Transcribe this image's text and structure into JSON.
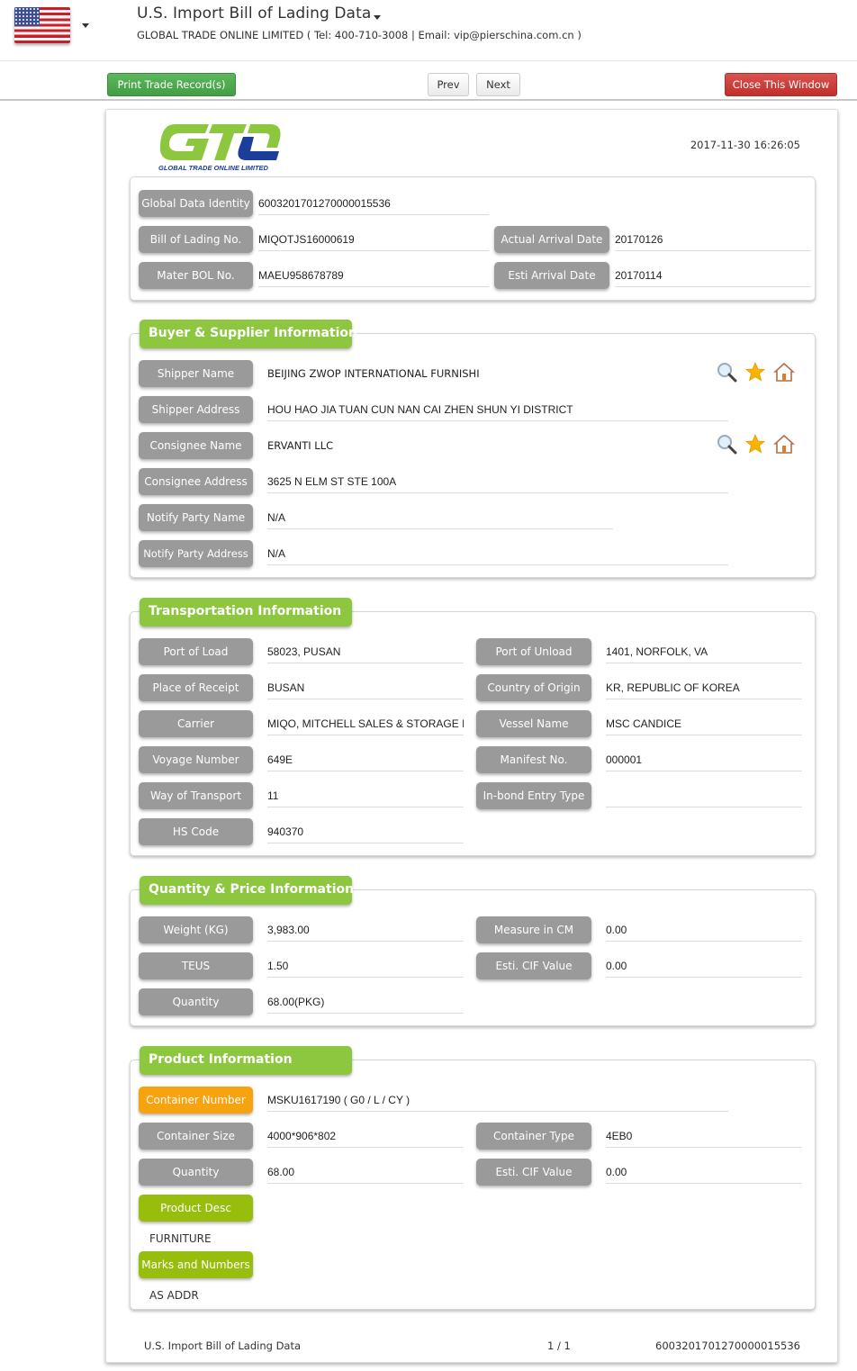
{
  "header": {
    "country_flag": "us-flag-icon",
    "title": "U.S. Import Bill of Lading Data",
    "subtitle": "GLOBAL TRADE ONLINE LIMITED ( Tel: 400-710-3008 | Email: vip@pierschina.com.cn )"
  },
  "toolbar": {
    "print_label": "Print Trade Record(s)",
    "prev_label": "Prev",
    "next_label": "Next",
    "close_label": "Close This Window"
  },
  "document": {
    "logo_text": "GLOBAL TRADE ONLINE LIMITED",
    "logo_letters": "GTO",
    "timestamp": "2017-11-30 16:26:05",
    "colors": {
      "section_green": "#8dc63f",
      "label_gray": "#9a9a9a",
      "label_orange": "#f5a30f",
      "label_olive": "#97be0d"
    }
  },
  "summary": {
    "global_data_identity": {
      "label": "Global Data Identity",
      "value": "6003201701270000015536"
    },
    "bill_of_lading": {
      "label": "Bill of Lading No.",
      "value": "MIQOTJS16000619"
    },
    "actual_arrival": {
      "label": "Actual Arrival Date",
      "value": "20170126"
    },
    "master_bol": {
      "label": "Mater BOL No.",
      "value": "MAEU958678789"
    },
    "esti_arrival": {
      "label": "Esti Arrival Date",
      "value": "20170114"
    }
  },
  "buyer_supplier": {
    "title": "Buyer & Supplier Information",
    "shipper_name": {
      "label": "Shipper Name",
      "value": "BEIJING ZWOP INTERNATIONAL FURNISHI"
    },
    "shipper_address": {
      "label": "Shipper Address",
      "value": "HOU HAO JIA TUAN CUN NAN CAI ZHEN SHUN YI DISTRICT"
    },
    "consignee_name": {
      "label": "Consignee Name",
      "value": "ERVANTI LLC"
    },
    "consignee_address": {
      "label": "Consignee Address",
      "value": "3625 N ELM ST STE 100A"
    },
    "notify_party_name": {
      "label": "Notify Party Name",
      "value": "N/A"
    },
    "notify_party_address": {
      "label": "Notify Party Address",
      "value": "N/A"
    }
  },
  "transportation": {
    "title": "Transportation Information",
    "port_of_load": {
      "label": "Port of Load",
      "value": "58023, PUSAN"
    },
    "port_of_unload": {
      "label": "Port of Unload",
      "value": "1401, NORFOLK, VA"
    },
    "place_of_receipt": {
      "label": "Place of Receipt",
      "value": "BUSAN"
    },
    "country_of_origin": {
      "label": "Country of Origin",
      "value": "KR, REPUBLIC OF KOREA"
    },
    "carrier": {
      "label": "Carrier",
      "value": "MIQO, MITCHELL SALES & STORAGE IN"
    },
    "vessel_name": {
      "label": "Vessel Name",
      "value": "MSC CANDICE"
    },
    "voyage_number": {
      "label": "Voyage Number",
      "value": "649E"
    },
    "manifest_no": {
      "label": "Manifest No.",
      "value": "000001"
    },
    "way_of_transport": {
      "label": "Way of Transport",
      "value": "11"
    },
    "inbond_entry_type": {
      "label": "In-bond Entry Type",
      "value": ""
    },
    "hs_code": {
      "label": "HS Code",
      "value": "940370"
    }
  },
  "quantity_price": {
    "title": "Quantity & Price Information",
    "weight": {
      "label": "Weight (KG)",
      "value": "3,983.00"
    },
    "measure": {
      "label": "Measure in CM",
      "value": "0.00"
    },
    "teus": {
      "label": "TEUS",
      "value": "1.50"
    },
    "esti_cif": {
      "label": "Esti. CIF Value",
      "value": "0.00"
    },
    "quantity": {
      "label": "Quantity",
      "value": "68.00(PKG)"
    }
  },
  "product": {
    "title": "Product Information",
    "container_number": {
      "label": "Container Number",
      "value": "MSKU1617190 ( G0 / L / CY )"
    },
    "container_size": {
      "label": "Container Size",
      "value": "4000*906*802"
    },
    "container_type": {
      "label": "Container Type",
      "value": "4EB0"
    },
    "quantity": {
      "label": "Quantity",
      "value": "68.00"
    },
    "esti_cif": {
      "label": "Esti. CIF Value",
      "value": "0.00"
    },
    "product_desc": {
      "label": "Product Desc",
      "value": "FURNITURE"
    },
    "marks_numbers": {
      "label": "Marks and Numbers",
      "value": "AS ADDR"
    }
  },
  "footer": {
    "left": "U.S. Import Bill of Lading Data",
    "page": "1 / 1",
    "right": "6003201701270000015536"
  }
}
